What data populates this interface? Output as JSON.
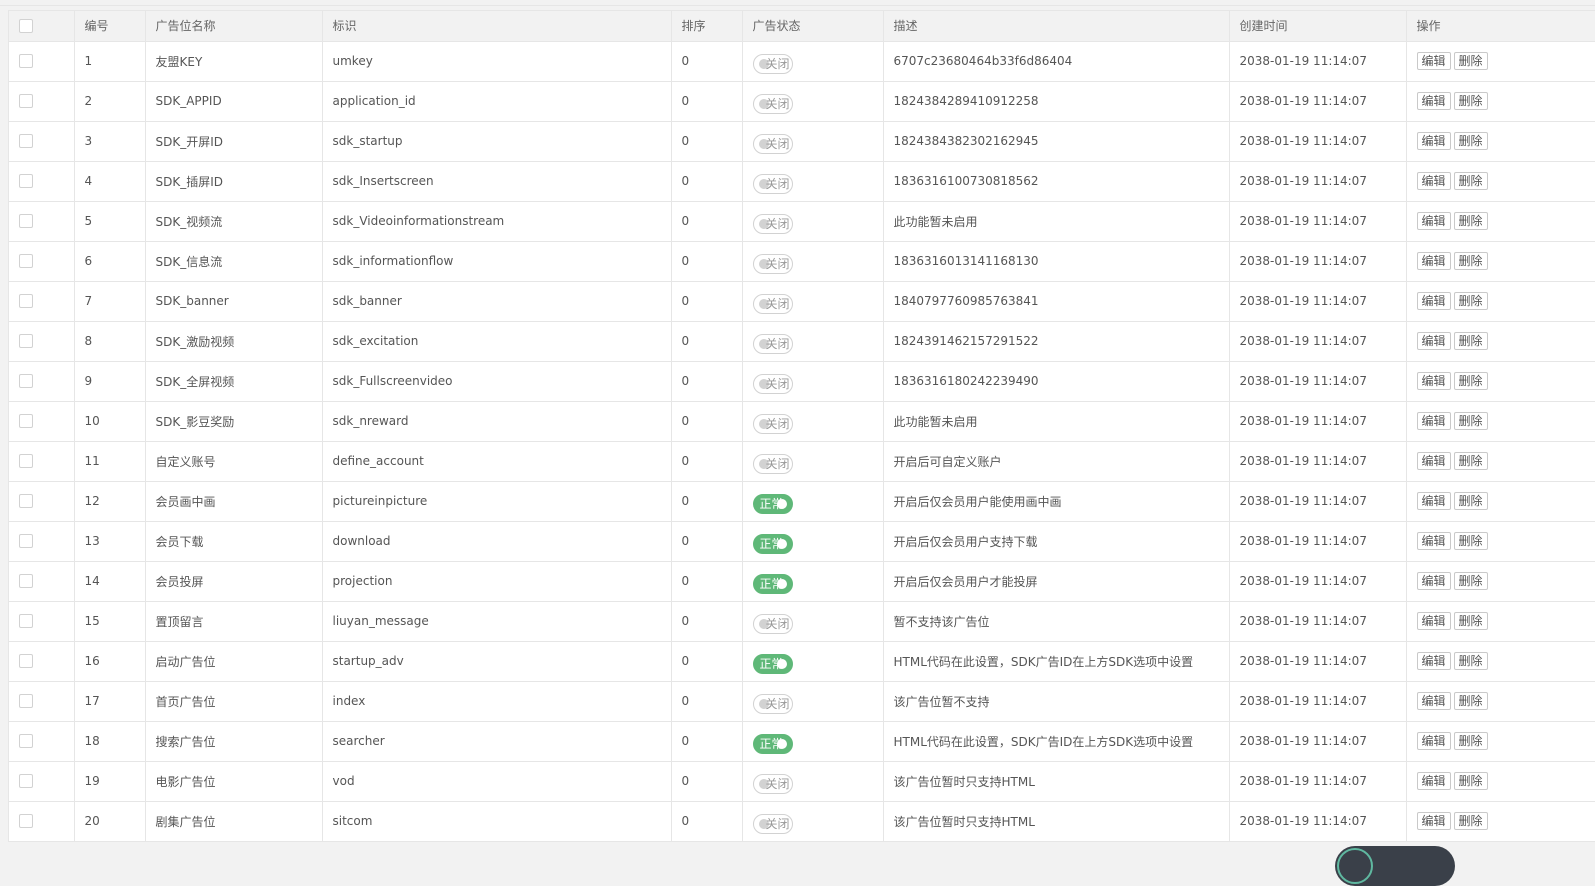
{
  "header": {
    "columns": [
      "编号",
      "广告位名称",
      "标识",
      "排序",
      "广告状态",
      "描述",
      "创建时间",
      "操作"
    ]
  },
  "actions": {
    "edit": "编辑",
    "delete": "删除"
  },
  "status_text": {
    "on": "正常",
    "off": "关闭"
  },
  "colors": {
    "switch_on": "#5fb878",
    "header_bg": "#f2f2f2",
    "border": "#e6e6e6"
  },
  "rows": [
    {
      "id": "1",
      "name": "友盟KEY",
      "key": "umkey",
      "sort": "0",
      "status": "off",
      "status_label": "关闭",
      "desc": "6707c23680464b33f6d86404",
      "created": "2038-01-19 11:14:07"
    },
    {
      "id": "2",
      "name": "SDK_APPID",
      "key": "application_id",
      "sort": "0",
      "status": "off",
      "status_label": "关闭",
      "desc": "1824384289410912258",
      "created": "2038-01-19 11:14:07"
    },
    {
      "id": "3",
      "name": "SDK_开屏ID",
      "key": "sdk_startup",
      "sort": "0",
      "status": "off",
      "status_label": "关闭",
      "desc": "1824384382302162945",
      "created": "2038-01-19 11:14:07"
    },
    {
      "id": "4",
      "name": "SDK_插屏ID",
      "key": "sdk_Insertscreen",
      "sort": "0",
      "status": "off",
      "status_label": "关闭",
      "desc": "1836316100730818562",
      "created": "2038-01-19 11:14:07"
    },
    {
      "id": "5",
      "name": "SDK_视频流",
      "key": "sdk_Videoinformationstream",
      "sort": "0",
      "status": "off",
      "status_label": "关闭",
      "desc": "此功能暂未启用",
      "created": "2038-01-19 11:14:07"
    },
    {
      "id": "6",
      "name": "SDK_信息流",
      "key": "sdk_informationflow",
      "sort": "0",
      "status": "off",
      "status_label": "关闭",
      "desc": "1836316013141168130",
      "created": "2038-01-19 11:14:07"
    },
    {
      "id": "7",
      "name": "SDK_banner",
      "key": "sdk_banner",
      "sort": "0",
      "status": "off",
      "status_label": "关闭",
      "desc": "1840797760985763841",
      "created": "2038-01-19 11:14:07"
    },
    {
      "id": "8",
      "name": "SDK_激励视频",
      "key": "sdk_excitation",
      "sort": "0",
      "status": "off",
      "status_label": "关闭",
      "desc": "1824391462157291522",
      "created": "2038-01-19 11:14:07"
    },
    {
      "id": "9",
      "name": "SDK_全屏视频",
      "key": "sdk_Fullscreenvideo",
      "sort": "0",
      "status": "off",
      "status_label": "关闭",
      "desc": "1836316180242239490",
      "created": "2038-01-19 11:14:07"
    },
    {
      "id": "10",
      "name": "SDK_影豆奖励",
      "key": "sdk_nreward",
      "sort": "0",
      "status": "off",
      "status_label": "关闭",
      "desc": "此功能暂未启用",
      "created": "2038-01-19 11:14:07"
    },
    {
      "id": "11",
      "name": "自定义账号",
      "key": "define_account",
      "sort": "0",
      "status": "off",
      "status_label": "关闭",
      "desc": "开启后可自定义账户",
      "created": "2038-01-19 11:14:07"
    },
    {
      "id": "12",
      "name": "会员画中画",
      "key": "pictureinpicture",
      "sort": "0",
      "status": "on",
      "status_label": "正常",
      "desc": "开启后仅会员用户能使用画中画",
      "created": "2038-01-19 11:14:07"
    },
    {
      "id": "13",
      "name": "会员下载",
      "key": "download",
      "sort": "0",
      "status": "on",
      "status_label": "正常",
      "desc": "开启后仅会员用户支持下载",
      "created": "2038-01-19 11:14:07"
    },
    {
      "id": "14",
      "name": "会员投屏",
      "key": "projection",
      "sort": "0",
      "status": "on",
      "status_label": "正常",
      "desc": "开启后仅会员用户才能投屏",
      "created": "2038-01-19 11:14:07"
    },
    {
      "id": "15",
      "name": "置顶留言",
      "key": "liuyan_message",
      "sort": "0",
      "status": "off",
      "status_label": "关闭",
      "desc": "暂不支持该广告位",
      "created": "2038-01-19 11:14:07"
    },
    {
      "id": "16",
      "name": "启动广告位",
      "key": "startup_adv",
      "sort": "0",
      "status": "on",
      "status_label": "正常",
      "desc": "HTML代码在此设置，SDK广告ID在上方SDK选项中设置",
      "created": "2038-01-19 11:14:07"
    },
    {
      "id": "17",
      "name": "首页广告位",
      "key": "index",
      "sort": "0",
      "status": "off",
      "status_label": "关闭",
      "desc": "该广告位暂不支持",
      "created": "2038-01-19 11:14:07"
    },
    {
      "id": "18",
      "name": "搜索广告位",
      "key": "searcher",
      "sort": "0",
      "status": "on",
      "status_label": "正常",
      "desc": "HTML代码在此设置，SDK广告ID在上方SDK选项中设置",
      "created": "2038-01-19 11:14:07"
    },
    {
      "id": "19",
      "name": "电影广告位",
      "key": "vod",
      "sort": "0",
      "status": "off",
      "status_label": "关闭",
      "desc": "该广告位暂时只支持HTML",
      "created": "2038-01-19 11:14:07"
    },
    {
      "id": "20",
      "name": "剧集广告位",
      "key": "sitcom",
      "sort": "0",
      "status": "off",
      "status_label": "关闭",
      "desc": "该广告位暂时只支持HTML",
      "created": "2038-01-19 11:14:07"
    }
  ]
}
